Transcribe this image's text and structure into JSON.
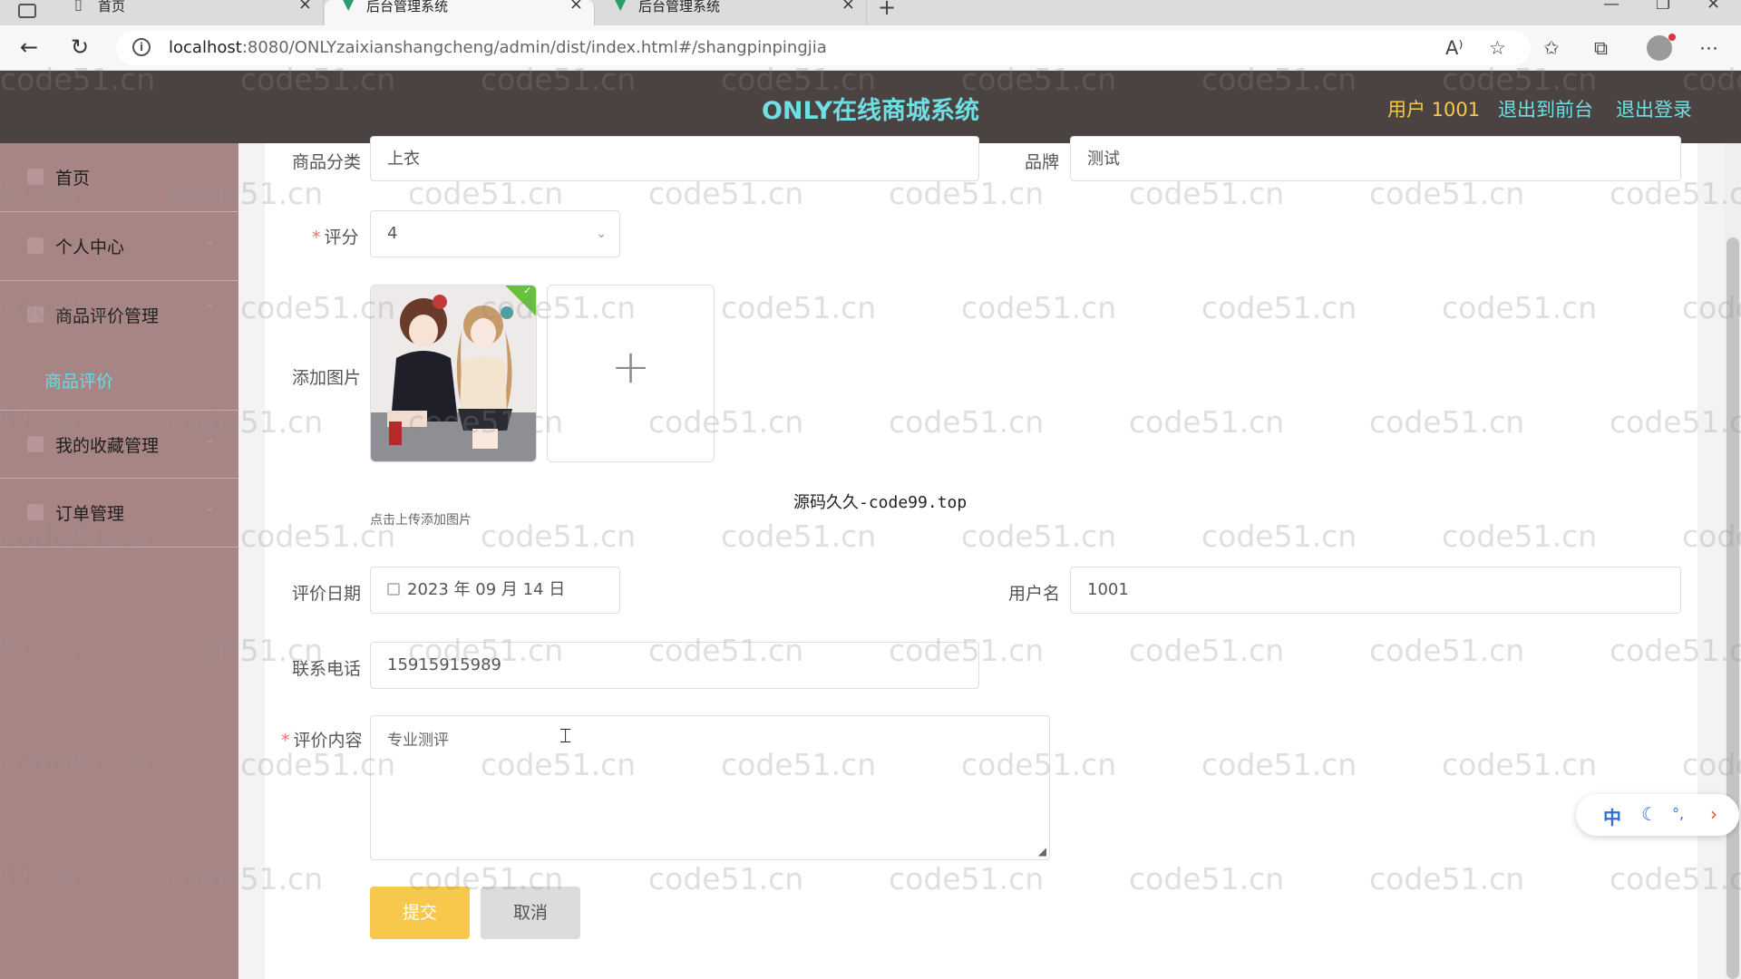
{
  "browser": {
    "tabs": [
      {
        "title": "首页",
        "active": false
      },
      {
        "title": "后台管理系统",
        "active": true
      },
      {
        "title": "后台管理系统",
        "active": false
      }
    ],
    "url_host": "localhost",
    "url_rest": ":8080/ONLYzaixianshangcheng/admin/dist/index.html#/shangpinpingjia"
  },
  "header": {
    "title": "ONLY在线商城系统",
    "user_label": "用户 1001",
    "front_link": "退出到前台",
    "logout_link": "退出登录",
    "colors": {
      "bar": "#4b4242",
      "title": "#6fdfe3",
      "user": "#f8c84c",
      "link": "#6fdfe3"
    }
  },
  "sidebar": {
    "items": [
      {
        "label": "首页"
      },
      {
        "label": "个人中心"
      },
      {
        "label": "商品评价管理"
      },
      {
        "label": "我的收藏管理"
      },
      {
        "label": "订单管理"
      }
    ],
    "active_sub": "商品评价",
    "colors": {
      "bg": "#a88585",
      "active": "#5ee0e6"
    }
  },
  "form": {
    "category": {
      "label": "商品分类",
      "value": "上衣"
    },
    "brand": {
      "label": "品牌",
      "value": "测试"
    },
    "rating": {
      "label": "评分",
      "value": "4",
      "required": true
    },
    "image": {
      "label": "添加图片",
      "hint": "点击上传添加图片"
    },
    "date": {
      "label": "评价日期",
      "value": "2023 年 09 月 14 日"
    },
    "username": {
      "label": "用户名",
      "value": "1001"
    },
    "phone": {
      "label": "联系电话",
      "value": "15915915989"
    },
    "content": {
      "label": "评价内容",
      "value": "专业测评",
      "required": true
    },
    "submit_label": "提交",
    "cancel_label": "取消"
  },
  "overlay_note": "源码久久-code99.top",
  "watermark_text": "code51.cn",
  "ime": {
    "lang": "中"
  }
}
